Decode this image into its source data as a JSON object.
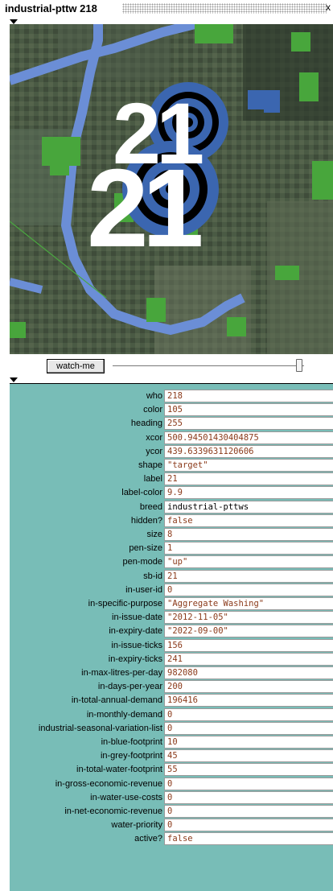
{
  "window": {
    "title": "industrial-pttw 218",
    "close": "x"
  },
  "view": {
    "agent_labels": [
      "21",
      "21"
    ]
  },
  "controls": {
    "watch_label": "watch-me"
  },
  "colors": {
    "panel_bg": "#78bdb7",
    "value_text": "#8b3a1a",
    "agent_blue": "#3b66b0",
    "water_blue": "#6b8ed6",
    "patch_green": "#48a63c"
  },
  "variables": [
    {
      "label": "who",
      "value": "218"
    },
    {
      "label": "color",
      "value": "105"
    },
    {
      "label": "heading",
      "value": "255"
    },
    {
      "label": "xcor",
      "value": "500.94501430404875"
    },
    {
      "label": "ycor",
      "value": "439.6339631120606"
    },
    {
      "label": "shape",
      "value": "\"target\""
    },
    {
      "label": "label",
      "value": "21"
    },
    {
      "label": "label-color",
      "value": "9.9"
    },
    {
      "label": "breed",
      "value": "industrial-pttws"
    },
    {
      "label": "hidden?",
      "value": "false"
    },
    {
      "label": "size",
      "value": "8"
    },
    {
      "label": "pen-size",
      "value": "1"
    },
    {
      "label": "pen-mode",
      "value": "\"up\""
    },
    {
      "label": "sb-id",
      "value": "21"
    },
    {
      "label": "in-user-id",
      "value": "0"
    },
    {
      "label": "in-specific-purpose",
      "value": "\"Aggregate Washing\""
    },
    {
      "label": "in-issue-date",
      "value": "\"2012-11-05\""
    },
    {
      "label": "in-expiry-date",
      "value": "\"2022-09-00\""
    },
    {
      "label": "in-issue-ticks",
      "value": "156"
    },
    {
      "label": "in-expiry-ticks",
      "value": "241"
    },
    {
      "label": "in-max-litres-per-day",
      "value": "982080"
    },
    {
      "label": "in-days-per-year",
      "value": "200"
    },
    {
      "label": "in-total-annual-demand",
      "value": "196416"
    },
    {
      "label": "in-monthly-demand",
      "value": "0"
    },
    {
      "label": "industrial-seasonal-variation-list",
      "value": "0"
    },
    {
      "label": "in-blue-footprint",
      "value": "10"
    },
    {
      "label": "in-grey-footprint",
      "value": "45"
    },
    {
      "label": "in-total-water-footprint",
      "value": "55"
    },
    {
      "label": "in-gross-economic-revenue",
      "value": "0"
    },
    {
      "label": "in-water-use-costs",
      "value": "0"
    },
    {
      "label": "in-net-economic-revenue",
      "value": "0"
    },
    {
      "label": "water-priority",
      "value": "0"
    },
    {
      "label": "active?",
      "value": "false"
    }
  ]
}
